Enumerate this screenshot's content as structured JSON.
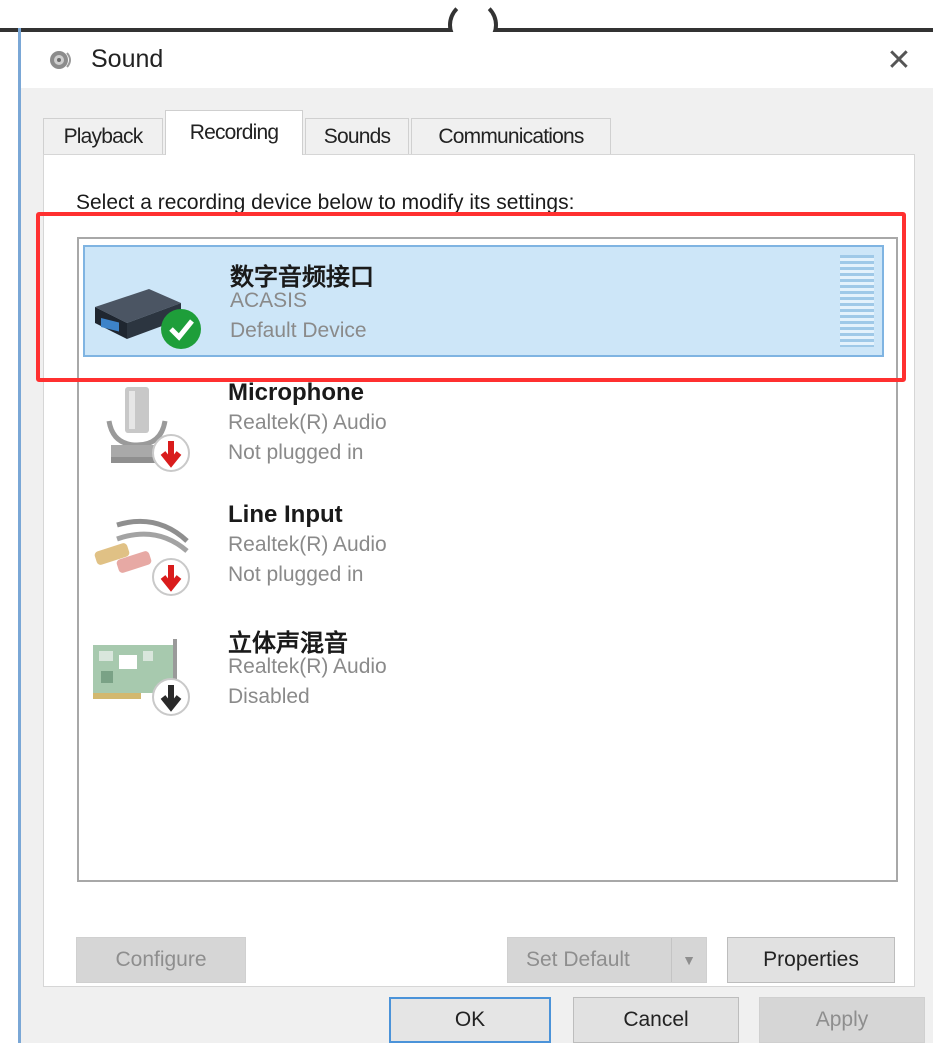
{
  "window": {
    "title": "Sound",
    "close_glyph": "✕"
  },
  "tabs": [
    {
      "label": "Playback",
      "active": false
    },
    {
      "label": "Recording",
      "active": true
    },
    {
      "label": "Sounds",
      "active": false
    },
    {
      "label": "Communications",
      "active": false
    }
  ],
  "panel": {
    "instruction": "Select a recording device below to modify its settings:"
  },
  "devices": [
    {
      "name": "数字音频接口",
      "line1": "ACASIS",
      "line2": "Default Device",
      "icon": "usb-audio-interface-icon",
      "status_icon": "green-check-icon",
      "selected": true
    },
    {
      "name": "Microphone",
      "line1": "Realtek(R) Audio",
      "line2": "Not plugged in",
      "icon": "microphone-icon",
      "status_icon": "red-unplugged-icon",
      "selected": false
    },
    {
      "name": "Line Input",
      "line1": "Realtek(R) Audio",
      "line2": "Not plugged in",
      "icon": "rca-cable-icon",
      "status_icon": "red-unplugged-icon",
      "selected": false
    },
    {
      "name": "立体声混音",
      "line1": "Realtek(R) Audio",
      "line2": "Disabled",
      "icon": "sound-card-icon",
      "status_icon": "disabled-arrow-icon",
      "selected": false
    }
  ],
  "buttons": {
    "configure": "Configure",
    "set_default": "Set Default",
    "properties": "Properties",
    "ok": "OK",
    "cancel": "Cancel",
    "apply": "Apply"
  },
  "colors": {
    "selection": "#cde6f8",
    "highlight_box": "#ff3030",
    "check": "#1e9e3a",
    "unplugged": "#d91c1c"
  }
}
